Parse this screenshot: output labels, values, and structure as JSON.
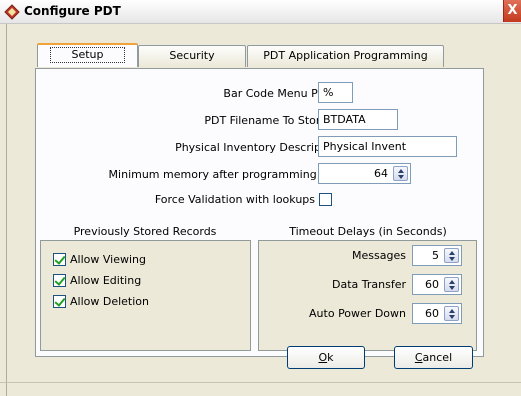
{
  "window": {
    "title": "Configure PDT",
    "close_label": "X"
  },
  "tabs": [
    {
      "label": "Setup",
      "active": true
    },
    {
      "label": "Security",
      "active": false
    },
    {
      "label": "PDT Application Programming",
      "active": false
    }
  ],
  "fields": {
    "bar_code_prefix": {
      "label": "Bar Code Menu Prefix",
      "value": "%"
    },
    "pdt_filename": {
      "label": "PDT Filename To Store To",
      "value": "BTDATA"
    },
    "inventory_desc": {
      "label": "Physical Inventory Description",
      "value": "Physical Invent"
    },
    "min_memory": {
      "label": "Minimum memory after programming PDT",
      "value": "64"
    },
    "force_validation": {
      "label": "Force Validation with lookups",
      "checked": false
    }
  },
  "stored_records": {
    "title": "Previously Stored Records",
    "items": [
      {
        "label": "Allow Viewing",
        "checked": true
      },
      {
        "label": "Allow Editing",
        "checked": true
      },
      {
        "label": "Allow Deletion",
        "checked": true
      }
    ]
  },
  "timeouts": {
    "title": "Timeout Delays (in Seconds)",
    "items": [
      {
        "label": "Messages",
        "value": "5"
      },
      {
        "label": "Data Transfer",
        "value": "60"
      },
      {
        "label": "Auto Power Down",
        "value": "60"
      }
    ]
  },
  "buttons": {
    "ok": {
      "mnemonic": "O",
      "rest": "k"
    },
    "cancel": {
      "mnemonic": "C",
      "rest": "ancel"
    }
  }
}
